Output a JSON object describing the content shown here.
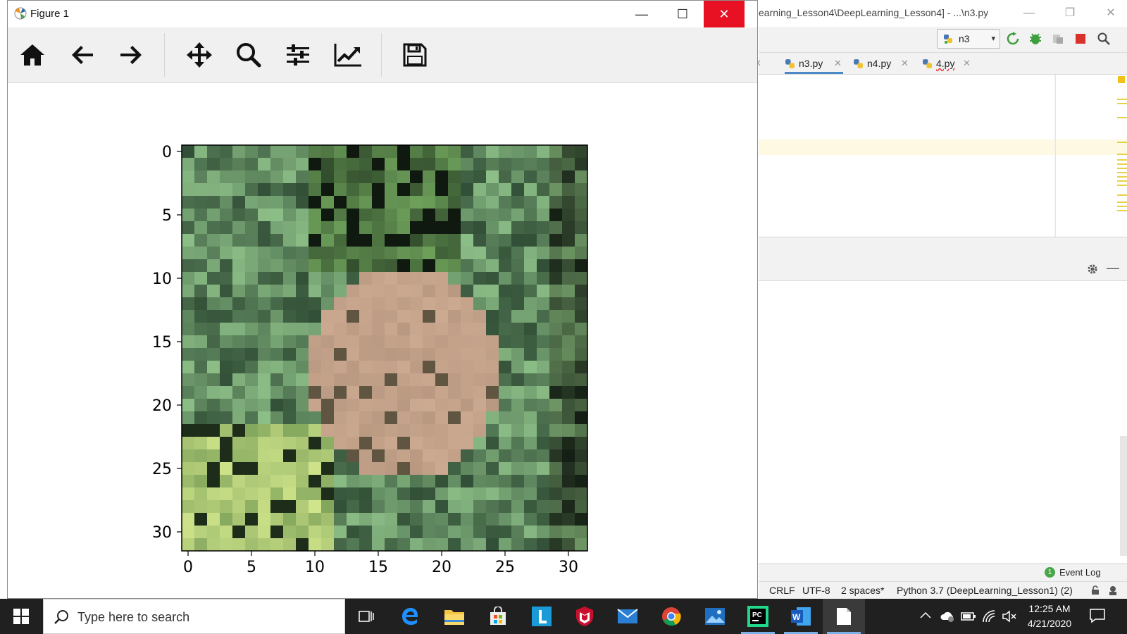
{
  "figure_window": {
    "title": "Figure 1",
    "controls": {
      "minimize": "—",
      "maximize": "☐",
      "close": "✕"
    },
    "toolbar": [
      "home",
      "back",
      "forward",
      "pan",
      "zoom",
      "configure-subplots",
      "edit-axis",
      "save"
    ]
  },
  "chart_data": {
    "type": "image",
    "xlabel": "",
    "ylabel": "",
    "xlim": [
      -0.5,
      31.5
    ],
    "ylim": [
      31.5,
      -0.5
    ],
    "xticks": [
      0,
      5,
      10,
      15,
      20,
      25,
      30
    ],
    "yticks": [
      0,
      5,
      10,
      15,
      20,
      25,
      30
    ],
    "xtick_labels": [
      "0",
      "5",
      "10",
      "15",
      "20",
      "25",
      "30"
    ],
    "ytick_labels": [
      "0",
      "5",
      "10",
      "15",
      "20",
      "25",
      "30"
    ],
    "image_size": [
      32,
      32
    ],
    "grid": false
  },
  "ide": {
    "title": "earning_Lesson4\\DeepLearning_Lesson4] - ...\\n3.py",
    "run_config": "n3",
    "tabs": [
      {
        "label": "n3.py",
        "active": true
      },
      {
        "label": "n4.py",
        "active": false
      },
      {
        "label": "4.py",
        "active": false
      }
    ],
    "event_log": {
      "count": "1",
      "label": "Event Log"
    },
    "status": {
      "line_sep": "CRLF",
      "encoding": "UTF-8",
      "indent": "2 spaces*",
      "interpreter": "Python 3.7 (DeepLearning_Lesson1) (2)"
    }
  },
  "taskbar": {
    "search_placeholder": "Type here to search",
    "time": "12:25 AM",
    "date": "4/21/2020",
    "apps": [
      "task-view",
      "edge",
      "file-explorer",
      "store",
      "l-app",
      "mcafee",
      "mail",
      "chrome",
      "photos",
      "pycharm",
      "word",
      "notepad"
    ]
  }
}
